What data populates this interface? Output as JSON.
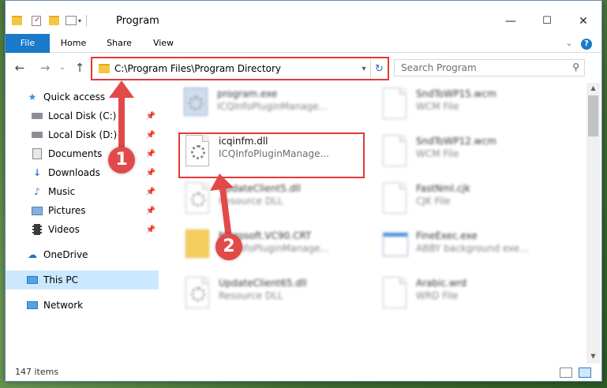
{
  "titlebar": {
    "title": "Program",
    "minimize": "—",
    "maximize": "☐",
    "close": "✕"
  },
  "ribbon": {
    "tabs": [
      "File",
      "Home",
      "Share",
      "View"
    ],
    "collapse": "⌄",
    "help": "?"
  },
  "nav": {
    "back": "←",
    "forward": "→",
    "up_history": "⌄",
    "up": "↑",
    "address": "C:\\Program Files\\Program Directory",
    "search_placeholder": "Search Program"
  },
  "sidebar": {
    "items": [
      {
        "label": "Quick access",
        "icon": "star-icon"
      },
      {
        "label": "Local Disk (C:)",
        "icon": "drive-icon",
        "pinned": true
      },
      {
        "label": "Local Disk (D:)",
        "icon": "drive-icon",
        "pinned": true
      },
      {
        "label": "Documents",
        "icon": "documents-icon",
        "pinned": true
      },
      {
        "label": "Downloads",
        "icon": "download-icon",
        "pinned": true
      },
      {
        "label": "Music",
        "icon": "music-icon",
        "pinned": true
      },
      {
        "label": "Pictures",
        "icon": "pictures-icon",
        "pinned": true
      },
      {
        "label": "Videos",
        "icon": "videos-icon",
        "pinned": true
      },
      {
        "label": "OneDrive",
        "icon": "cloud-icon"
      },
      {
        "label": "This PC",
        "icon": "computer-icon",
        "selected": true
      },
      {
        "label": "Network",
        "icon": "network-icon"
      }
    ]
  },
  "files": {
    "left": [
      {
        "name": "program.exe",
        "type": "ICQInfoPluginManage..."
      },
      {
        "name": "icqinfm.dll",
        "type": "ICQInfoPluginManage..."
      },
      {
        "name": "UpdateClient5.dll",
        "type": "Resource DLL"
      },
      {
        "name": "Microsoft.VC90.CRT",
        "type": "ICQInfoPluginManage..."
      },
      {
        "name": "UpdateClient65.dll",
        "type": "Resource DLL"
      }
    ],
    "right": [
      {
        "name": "SndToWP15.wcm",
        "type": "WCM File"
      },
      {
        "name": "SndToWP12.wcm",
        "type": "WCM File"
      },
      {
        "name": "FastNml.cjk",
        "type": "CJK File"
      },
      {
        "name": "FineExec.exe",
        "type": "ABBY background exe..."
      },
      {
        "name": "Arabic.wrd",
        "type": "WRD File"
      }
    ]
  },
  "status": {
    "count": "147 items"
  },
  "callouts": [
    "1",
    "2"
  ],
  "colors": {
    "accent": "#1979ca",
    "highlight": "#e03a3a",
    "callout": "#e24a4a"
  }
}
